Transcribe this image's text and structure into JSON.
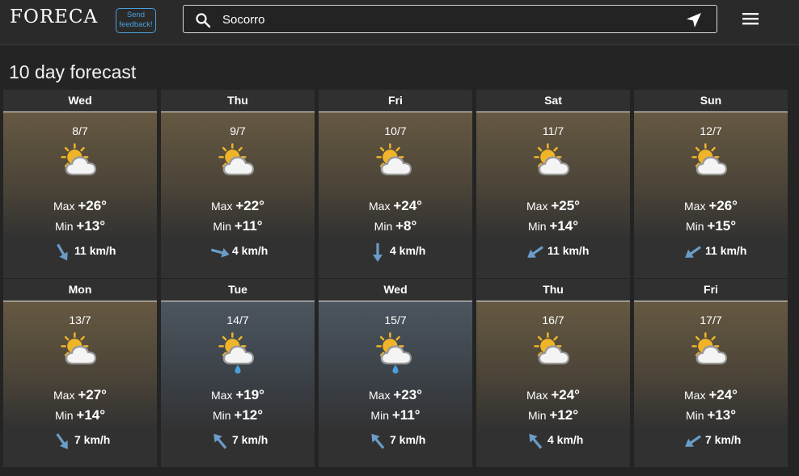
{
  "header": {
    "logo_text": "FORECA",
    "feedback_line1": "Send",
    "feedback_line2": "feedback!",
    "search_value": "Socorro"
  },
  "page_title": "10 day forecast",
  "max_label": "Max",
  "min_label": "Min",
  "days": [
    {
      "day": "Wed",
      "date": "8/7",
      "icon": "partly-cloudy-icon",
      "max": "+26°",
      "min": "+13°",
      "wind": "11 km/h",
      "wind_dir_deg": 150,
      "sky": "sunny"
    },
    {
      "day": "Thu",
      "date": "9/7",
      "icon": "partly-cloudy-icon",
      "max": "+22°",
      "min": "+11°",
      "wind": "4 km/h",
      "wind_dir_deg": 105,
      "sky": "sunny"
    },
    {
      "day": "Fri",
      "date": "10/7",
      "icon": "partly-cloudy-icon",
      "max": "+24°",
      "min": "+8°",
      "wind": "4 km/h",
      "wind_dir_deg": 180,
      "sky": "sunny"
    },
    {
      "day": "Sat",
      "date": "11/7",
      "icon": "partly-cloudy-icon",
      "max": "+25°",
      "min": "+14°",
      "wind": "11 km/h",
      "wind_dir_deg": 235,
      "sky": "sunny"
    },
    {
      "day": "Sun",
      "date": "12/7",
      "icon": "partly-cloudy-icon",
      "max": "+26°",
      "min": "+15°",
      "wind": "11 km/h",
      "wind_dir_deg": 235,
      "sky": "sunny"
    },
    {
      "day": "Mon",
      "date": "13/7",
      "icon": "partly-cloudy-icon",
      "max": "+27°",
      "min": "+14°",
      "wind": "7 km/h",
      "wind_dir_deg": 145,
      "sky": "sunny"
    },
    {
      "day": "Tue",
      "date": "14/7",
      "icon": "rain-shower-icon",
      "max": "+19°",
      "min": "+12°",
      "wind": "7 km/h",
      "wind_dir_deg": 320,
      "sky": "cloudy"
    },
    {
      "day": "Wed",
      "date": "15/7",
      "icon": "rain-shower-icon",
      "max": "+23°",
      "min": "+11°",
      "wind": "7 km/h",
      "wind_dir_deg": 320,
      "sky": "cloudy"
    },
    {
      "day": "Thu",
      "date": "16/7",
      "icon": "partly-cloudy-icon",
      "max": "+24°",
      "min": "+12°",
      "wind": "4 km/h",
      "wind_dir_deg": 320,
      "sky": "sunny"
    },
    {
      "day": "Fri",
      "date": "17/7",
      "icon": "partly-cloudy-icon",
      "max": "+24°",
      "min": "+13°",
      "wind": "7 km/h",
      "wind_dir_deg": 235,
      "sky": "sunny"
    }
  ],
  "colors": {
    "arrow": "#6b9cc8",
    "sun": "#f0b429",
    "cloud": "#f4f4f4",
    "rain": "#4a9fdc",
    "feedback": "#4a9fdc"
  }
}
